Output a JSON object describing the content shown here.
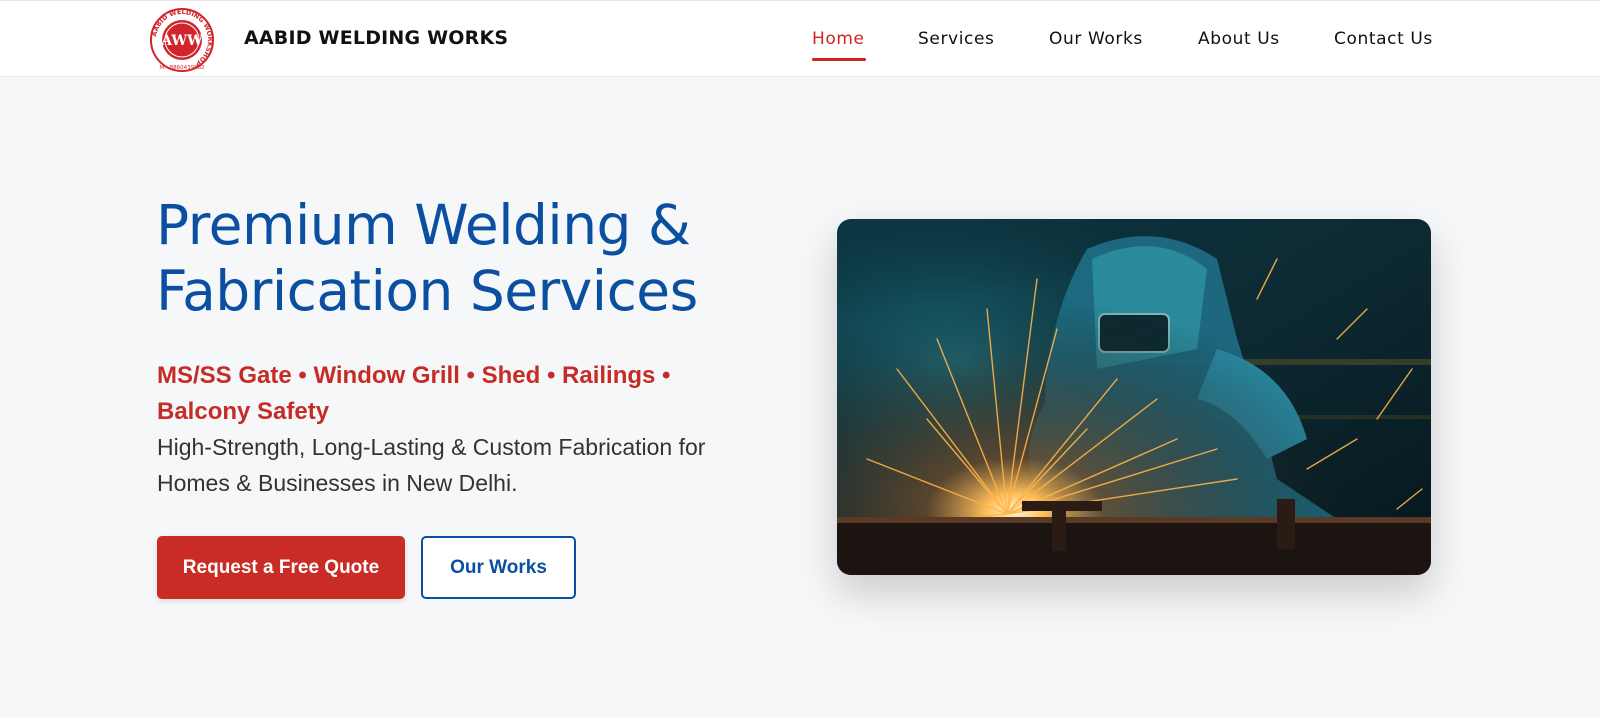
{
  "brand": {
    "name": "AABID WELDING WORKS",
    "logo_initials": "AWW",
    "logo_ring_text": "AABID WELDING WORKSHOP",
    "logo_phone": "M.- 8860439882"
  },
  "nav": {
    "items": [
      {
        "label": "Home",
        "active": true
      },
      {
        "label": "Services",
        "active": false
      },
      {
        "label": "Our Works",
        "active": false
      },
      {
        "label": "About Us",
        "active": false
      },
      {
        "label": "Contact Us",
        "active": false
      }
    ]
  },
  "hero": {
    "title_line1": "Premium Welding &",
    "title_line2": "Fabrication Services",
    "services_line": "MS/SS Gate • Window Grill • Shed • Railings • Balcony Safety",
    "description": "High-Strength, Long-Lasting & Custom Fabrication for Homes & Businesses in New Delhi.",
    "cta_primary": "Request a Free Quote",
    "cta_secondary": "Our Works",
    "image_icon": "welder-sparks-photo"
  },
  "colors": {
    "accent_red": "#c82c24",
    "nav_active_red": "#d22323",
    "brand_blue": "#0a4fa0",
    "page_bg": "#f6f7f9"
  }
}
